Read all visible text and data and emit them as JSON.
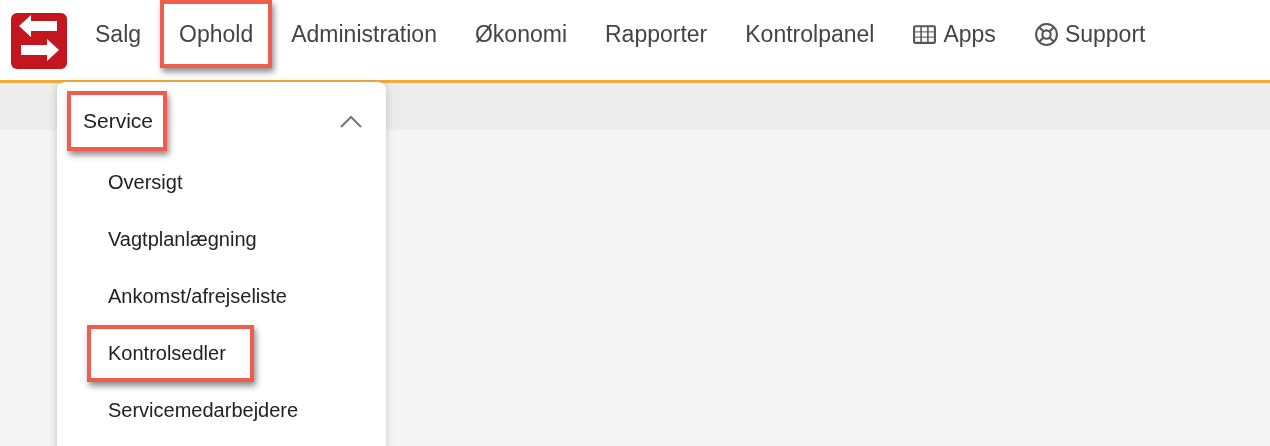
{
  "nav": [
    {
      "kind": "text",
      "label": "Salg",
      "highlighted": false
    },
    {
      "kind": "text",
      "label": "Ophold",
      "highlighted": true
    },
    {
      "kind": "text",
      "label": "Administration",
      "highlighted": false
    },
    {
      "kind": "text",
      "label": "Økonomi",
      "highlighted": false
    },
    {
      "kind": "text",
      "label": "Rapporter",
      "highlighted": false
    },
    {
      "kind": "text",
      "label": "Kontrolpanel",
      "highlighted": false
    },
    {
      "kind": "apps",
      "label": "Apps",
      "highlighted": false
    },
    {
      "kind": "support",
      "label": "Support",
      "highlighted": false
    }
  ],
  "dropdown": {
    "section": {
      "label": "Service",
      "expanded": true,
      "highlighted": true
    },
    "items": [
      {
        "label": "Oversigt",
        "highlighted": false
      },
      {
        "label": "Vagtplanlægning",
        "highlighted": false
      },
      {
        "label": "Ankomst/afrejseliste",
        "highlighted": false
      },
      {
        "label": "Kontrolsedler",
        "highlighted": true
      },
      {
        "label": "Servicemedarbejdere",
        "highlighted": false
      }
    ]
  }
}
